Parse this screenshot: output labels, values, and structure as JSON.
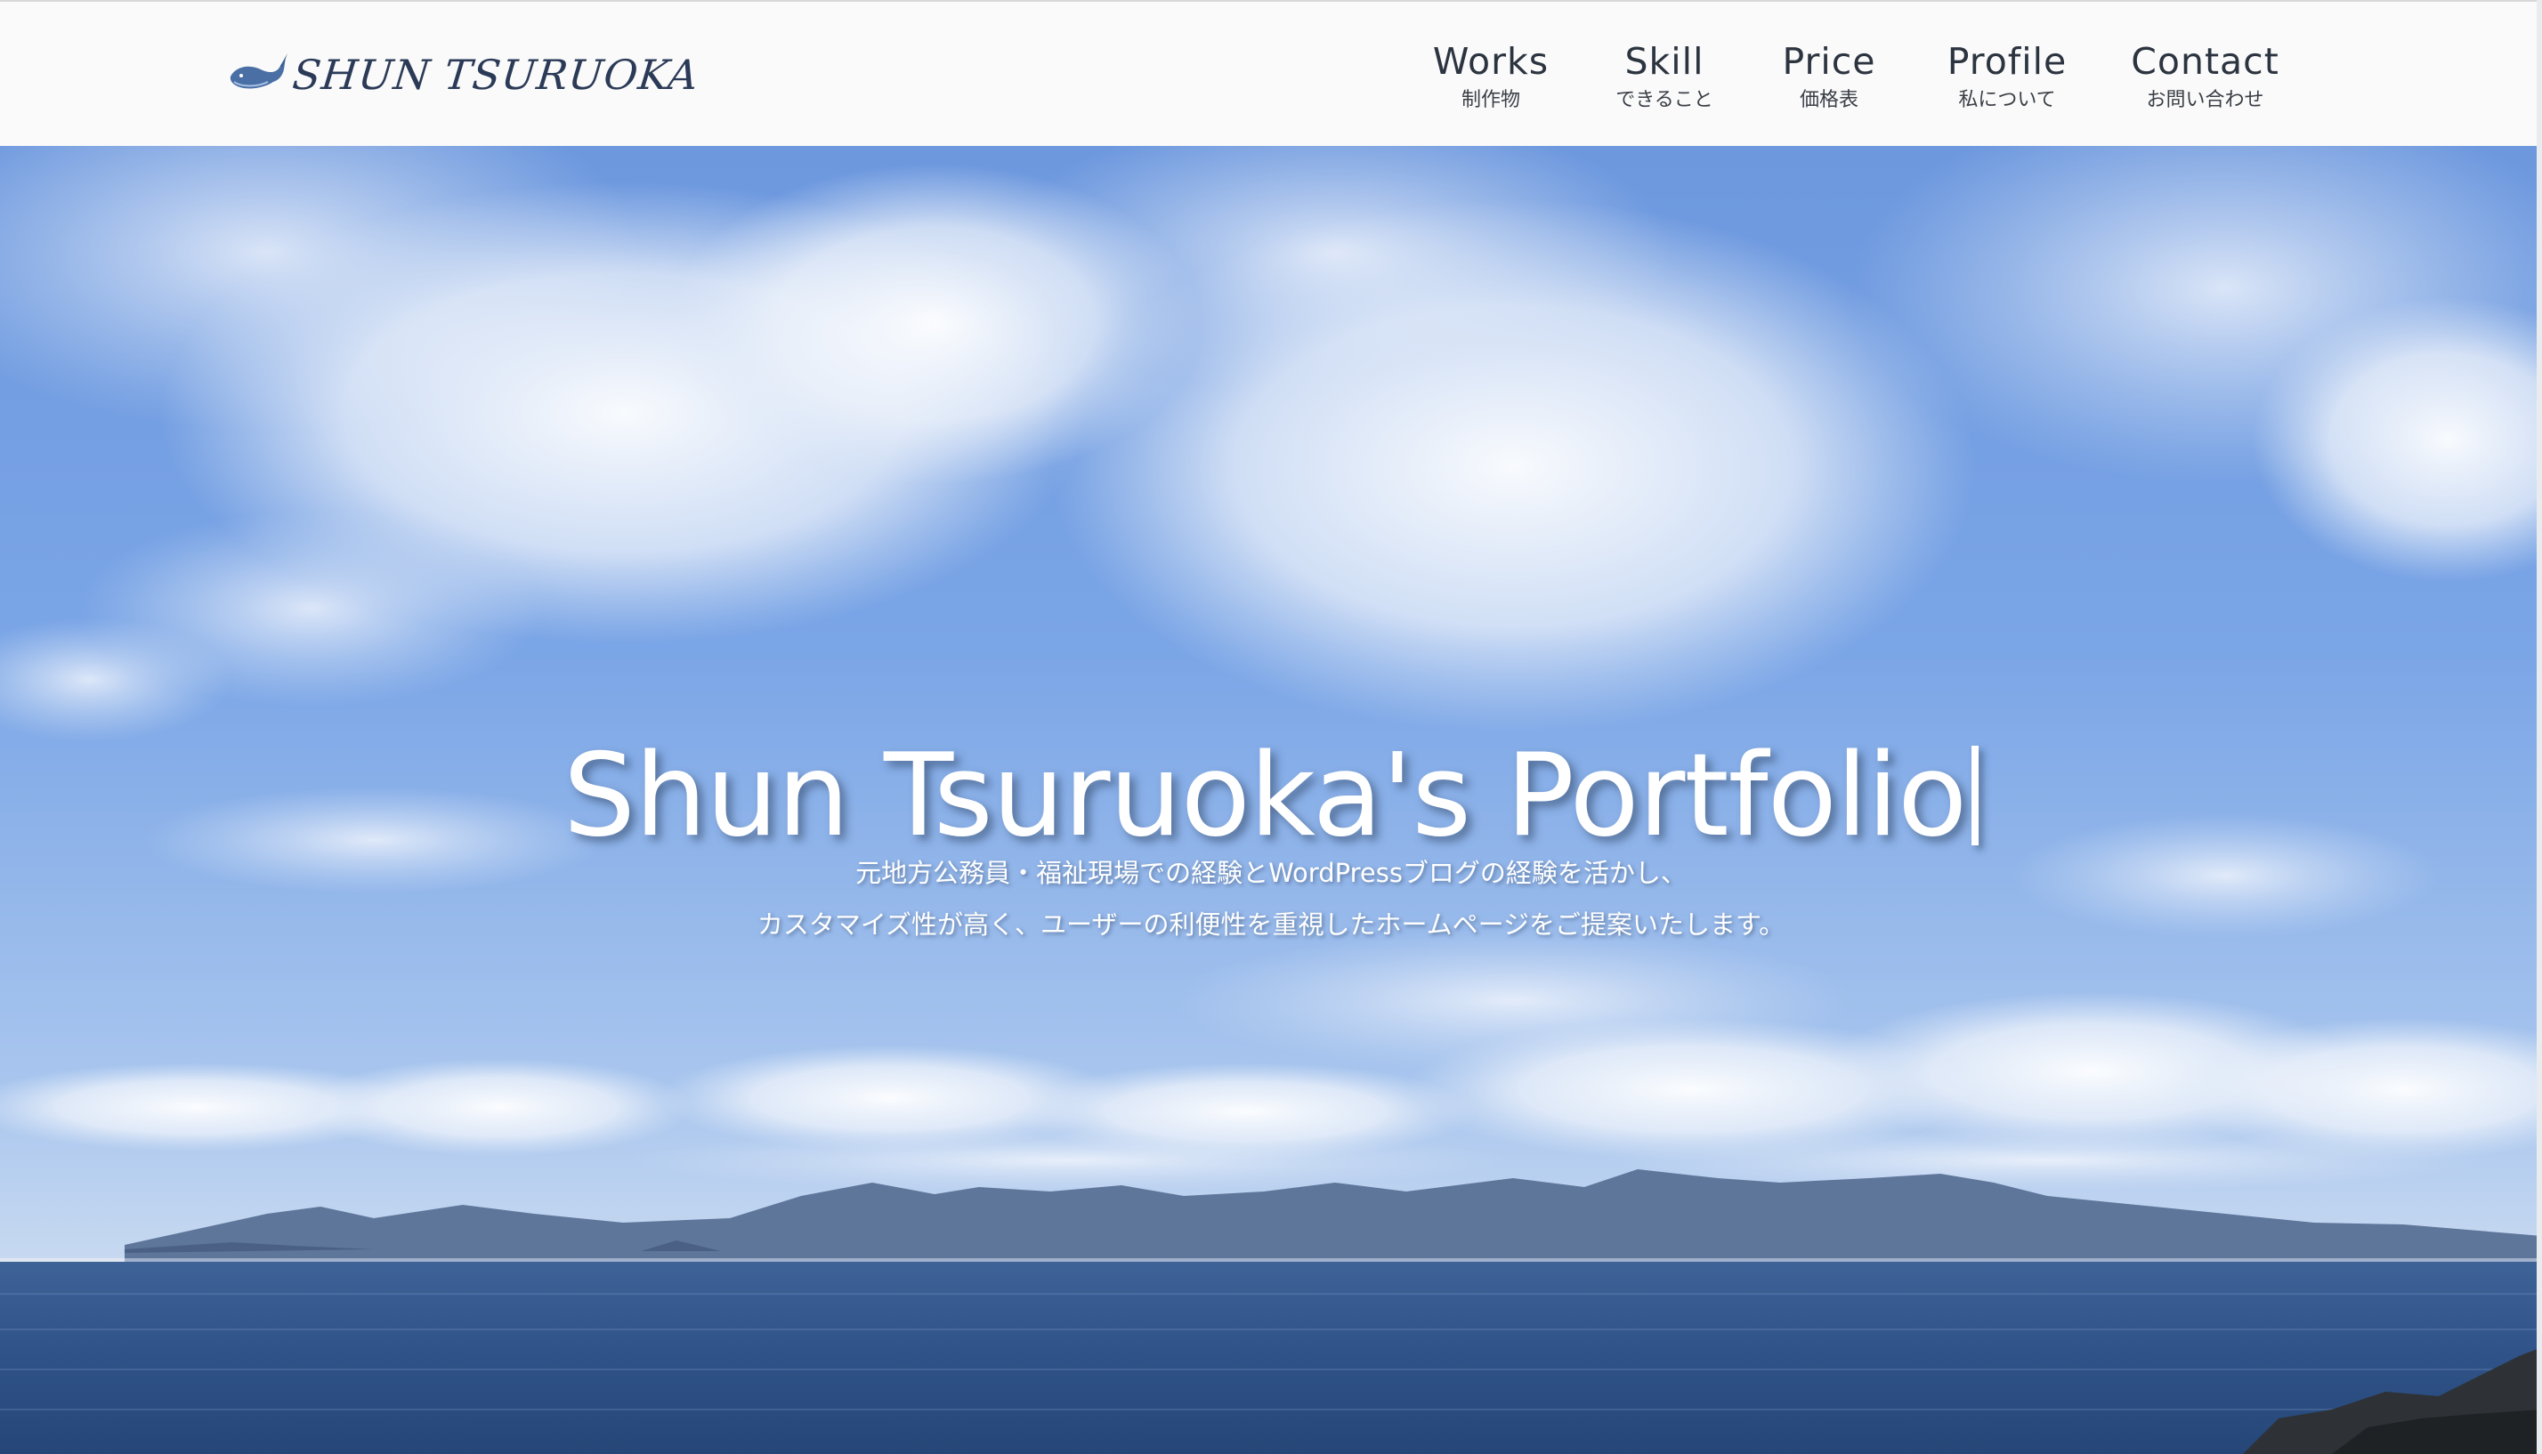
{
  "header": {
    "logo_text": "SHUN TSURUOKA",
    "logo_icon": "whale-icon",
    "nav": [
      {
        "label": "Works",
        "sub": "制作物"
      },
      {
        "label": "Skill",
        "sub": "できること"
      },
      {
        "label": "Price",
        "sub": "価格表"
      },
      {
        "label": "Profile",
        "sub": "私について"
      },
      {
        "label": "Contact",
        "sub": "お問い合わせ"
      }
    ]
  },
  "hero": {
    "title": "Shun Tsuruoka's Portfolio",
    "description_line1": "元地方公務員・福祉現場での経験とWordPressブログの経験を活かし、",
    "description_line2": "カスタマイズ性が高く、ユーザーの利便性を重視したホームページをご提案いたします。"
  },
  "colors": {
    "header_bg": "#fafafa",
    "nav_text": "#2c3440",
    "logo_text": "#2b3a57",
    "whale": "#4a6fa5",
    "sky_top": "#6e9be0",
    "sea": "#2d5189"
  }
}
